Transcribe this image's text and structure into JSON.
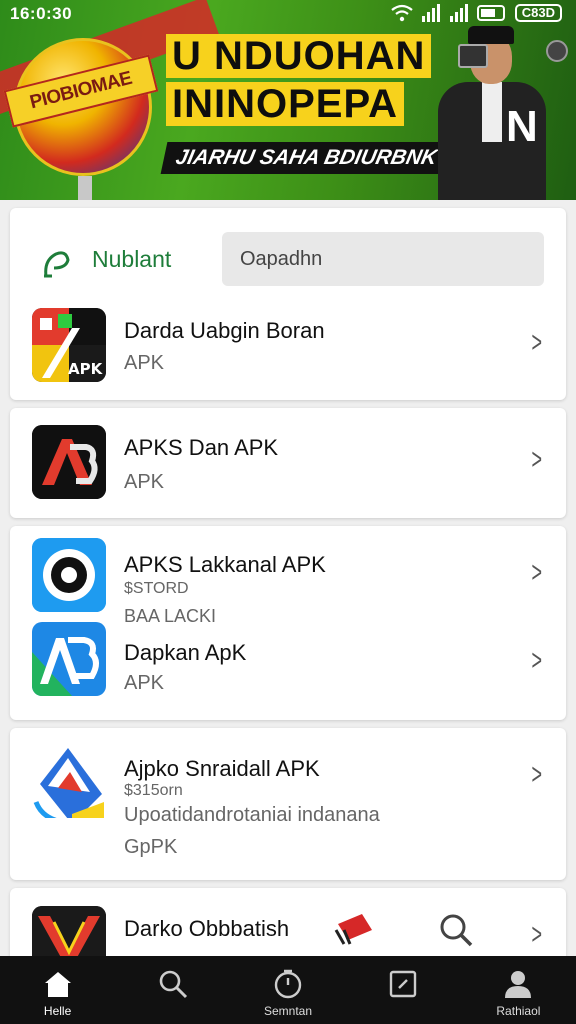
{
  "status": {
    "time": "16:0:30",
    "battery": "C83D"
  },
  "banner": {
    "ball_label": "PIOBIOMAE",
    "title_line1": "U NDUOHAN",
    "title_line2": "ININOPEPA",
    "subtitle": "JIARHU SAHA BDIURBNK",
    "person_letter": "N"
  },
  "search": {
    "brand": "Nublant",
    "placeholder": "Oapadhn"
  },
  "apps": [
    {
      "name": "Darda Uabgin Boran",
      "sub": "APK"
    },
    {
      "name": "APKS Dan APK",
      "sub": "APK"
    },
    {
      "name": "APKS Lakkanal APK",
      "small1": "$STORD",
      "small2": "BAA LACKI"
    },
    {
      "name": "Dapkan ApK",
      "sub": "APK"
    },
    {
      "name": "Ajpko Snraidall APK",
      "small1": "$315orn",
      "desc": "Upoatidandrotaniai indanana",
      "sub": "GpPK"
    },
    {
      "name": "Darko Obbbatish"
    }
  ],
  "nav": [
    {
      "label": "Helle",
      "icon": "home-icon",
      "active": true
    },
    {
      "label": "",
      "icon": "search-icon",
      "active": false
    },
    {
      "label": "Semntan",
      "icon": "timer-icon",
      "active": false
    },
    {
      "label": "",
      "icon": "square-icon",
      "active": false
    },
    {
      "label": "Rathiaol",
      "icon": "person-icon",
      "active": false
    }
  ]
}
